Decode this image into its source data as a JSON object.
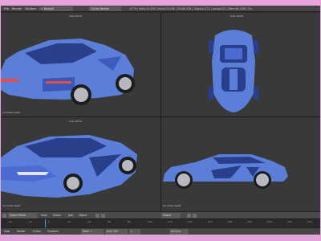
{
  "window": {
    "title": "Blender"
  },
  "menubar": {
    "items": [
      "File",
      "Render",
      "Window",
      "Help"
    ],
    "layout": "Default",
    "engine": "Cycles Render",
    "info": "v2.79 | Verts:34,206 | Faces:33,498 | Tris:66,918 | Objects:1/12 | Lamps:0/2 | Mem:64.25M | Car"
  },
  "viewports": {
    "top_left": {
      "label": "User Ortho",
      "name": "(1) Cube.mesh"
    },
    "top_right": {
      "label": "User Ortho",
      "name": ""
    },
    "bottom_left": {
      "label": "User Ortho",
      "name": "(1) Cube.mesh"
    },
    "bottom_right": {
      "label": "",
      "name": "(1) Cube.mesh"
    }
  },
  "header": {
    "mode": "Object Mode",
    "view": "View",
    "select": "Select",
    "add": "Add",
    "object": "Object",
    "pivot": "Global"
  },
  "timeline": {
    "ticks": [
      "-40",
      "-20",
      "0",
      "20",
      "40",
      "60",
      "80",
      "100",
      "120",
      "140",
      "160",
      "180",
      "200",
      "220",
      "240",
      "260"
    ]
  },
  "status": {
    "view": "View",
    "marker": "Marker",
    "frame": "Frame",
    "playback": "Playback",
    "start": "Start: 1",
    "end": "End: 250",
    "current": "1",
    "sync": "No Sync"
  },
  "colors": {
    "car_body": "#5b7fd8",
    "car_dark": "#2a3f8c",
    "viewport_bg": "#393939",
    "titlebar_bg": "#e8a4de"
  }
}
